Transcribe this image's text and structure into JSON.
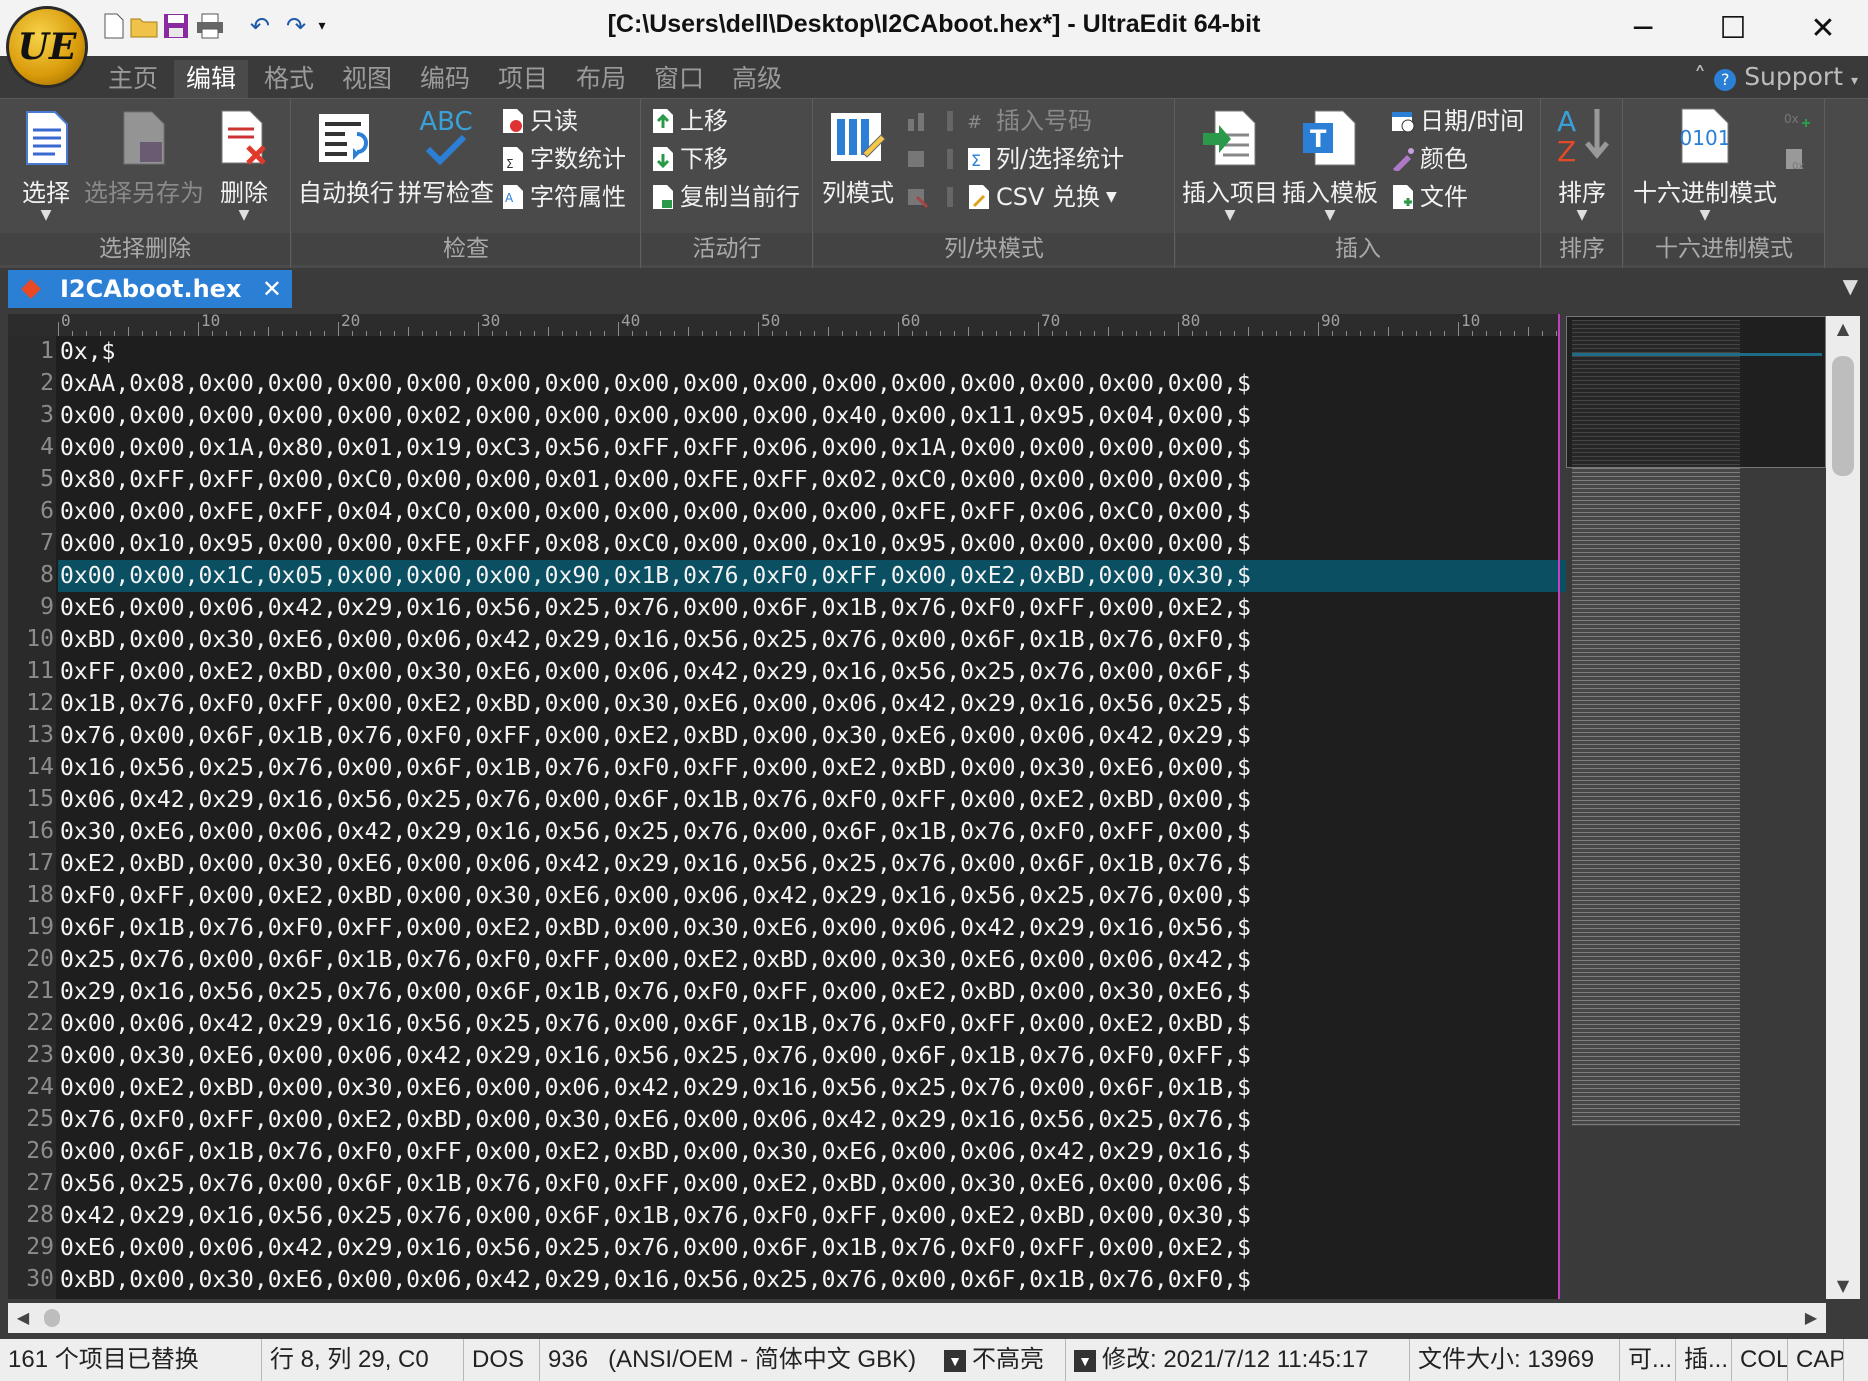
{
  "window": {
    "title": "[C:\\Users\\dell\\Desktop\\I2CAboot.hex*] - UltraEdit 64-bit",
    "logo_text": "UE",
    "controls": [
      "─",
      "☐",
      "✕"
    ]
  },
  "quick_access": [
    "new-file-icon",
    "open-folder-icon",
    "save-icon",
    "print-icon",
    "undo-icon",
    "redo-icon",
    "customize-dropdown-icon"
  ],
  "menu": {
    "tabs": [
      "主页",
      "编辑",
      "格式",
      "视图",
      "编码",
      "项目",
      "布局",
      "窗口",
      "高级"
    ],
    "active": "编辑",
    "support": "Support"
  },
  "ribbon": {
    "groups": {
      "select_delete": "选择删除",
      "check": "检查",
      "active_line": "活动行",
      "column_block": "列/块模式",
      "insert": "插入",
      "sort": "排序",
      "hex": "十六进制模式"
    },
    "buttons": {
      "select": "选择",
      "select_save_as": "选择另存为",
      "delete": "删除",
      "word_wrap": "自动换行",
      "spell_check": "拼写检查",
      "spell_icon_text": "ABC",
      "read_only": "只读",
      "word_count": "字数统计",
      "char_props": "字符属性",
      "move_up": "上移",
      "move_down": "下移",
      "copy_line": "复制当前行",
      "column_mode": "列模式",
      "insert_number": "插入号码",
      "column_stats": "列/选择统计",
      "csv_convert": "CSV 兑换",
      "insert_item": "插入项目",
      "insert_template": "插入模板",
      "datetime": "日期/时间",
      "color": "颜色",
      "file": "文件",
      "sort": "排序",
      "sort_icon_a": "A",
      "sort_icon_z": "Z",
      "hex_mode": "十六进制模式",
      "hex_icon_text": "0101"
    }
  },
  "tab": {
    "filename": "I2CAboot.hex",
    "close": "✕",
    "dropdown": "▼"
  },
  "ruler": {
    "labels": [
      "0",
      "10",
      "20",
      "30",
      "40",
      "50",
      "60",
      "70",
      "80",
      "90",
      "10"
    ]
  },
  "editor": {
    "current_line": 8,
    "lines": [
      "0x\u0019,$",
      "0xAA,0x08,0x00,0x00,0x00,0x00,0x00,0x00,0x00,0x00,0x00,0x00,0x00,0x00,0x00,0x00,0x00,$",
      "0x00,0x00,0x00,0x00,0x00,0x02,0x00,0x00,0x00,0x00,0x00,0x40,0x00,0x11,0x95,0x04,0x00,$",
      "0x00,0x00,0x1A,0x80,0x01,0x19,0xC3,0x56,0xFF,0xFF,0x06,0x00,0x1A,0x00,0x00,0x00,0x00,$",
      "0x80,0xFF,0xFF,0x00,0xC0,0x00,0x00,0x01,0x00,0xFE,0xFF,0x02,0xC0,0x00,0x00,0x00,0x00,$",
      "0x00,0x00,0xFE,0xFF,0x04,0xC0,0x00,0x00,0x00,0x00,0x00,0x00,0xFE,0xFF,0x06,0xC0,0x00,$",
      "0x00,0x10,0x95,0x00,0x00,0xFE,0xFF,0x08,0xC0,0x00,0x00,0x10,0x95,0x00,0x00,0x00,0x00,$",
      "0x00,0x00,0x1C,0x05,0x00,0x00,0x00,0x90,0x1B,0x76,0xF0,0xFF,0x00,0xE2,0xBD,0x00,0x30,$",
      "0xE6,0x00,0x06,0x42,0x29,0x16,0x56,0x25,0x76,0x00,0x6F,0x1B,0x76,0xF0,0xFF,0x00,0xE2,$",
      "0xBD,0x00,0x30,0xE6,0x00,0x06,0x42,0x29,0x16,0x56,0x25,0x76,0x00,0x6F,0x1B,0x76,0xF0,$",
      "0xFF,0x00,0xE2,0xBD,0x00,0x30,0xE6,0x00,0x06,0x42,0x29,0x16,0x56,0x25,0x76,0x00,0x6F,$",
      "0x1B,0x76,0xF0,0xFF,0x00,0xE2,0xBD,0x00,0x30,0xE6,0x00,0x06,0x42,0x29,0x16,0x56,0x25,$",
      "0x76,0x00,0x6F,0x1B,0x76,0xF0,0xFF,0x00,0xE2,0xBD,0x00,0x30,0xE6,0x00,0x06,0x42,0x29,$",
      "0x16,0x56,0x25,0x76,0x00,0x6F,0x1B,0x76,0xF0,0xFF,0x00,0xE2,0xBD,0x00,0x30,0xE6,0x00,$",
      "0x06,0x42,0x29,0x16,0x56,0x25,0x76,0x00,0x6F,0x1B,0x76,0xF0,0xFF,0x00,0xE2,0xBD,0x00,$",
      "0x30,0xE6,0x00,0x06,0x42,0x29,0x16,0x56,0x25,0x76,0x00,0x6F,0x1B,0x76,0xF0,0xFF,0x00,$",
      "0xE2,0xBD,0x00,0x30,0xE6,0x00,0x06,0x42,0x29,0x16,0x56,0x25,0x76,0x00,0x6F,0x1B,0x76,$",
      "0xF0,0xFF,0x00,0xE2,0xBD,0x00,0x30,0xE6,0x00,0x06,0x42,0x29,0x16,0x56,0x25,0x76,0x00,$",
      "0x6F,0x1B,0x76,0xF0,0xFF,0x00,0xE2,0xBD,0x00,0x30,0xE6,0x00,0x06,0x42,0x29,0x16,0x56,$",
      "0x25,0x76,0x00,0x6F,0x1B,0x76,0xF0,0xFF,0x00,0xE2,0xBD,0x00,0x30,0xE6,0x00,0x06,0x42,$",
      "0x29,0x16,0x56,0x25,0x76,0x00,0x6F,0x1B,0x76,0xF0,0xFF,0x00,0xE2,0xBD,0x00,0x30,0xE6,$",
      "0x00,0x06,0x42,0x29,0x16,0x56,0x25,0x76,0x00,0x6F,0x1B,0x76,0xF0,0xFF,0x00,0xE2,0xBD,$",
      "0x00,0x30,0xE6,0x00,0x06,0x42,0x29,0x16,0x56,0x25,0x76,0x00,0x6F,0x1B,0x76,0xF0,0xFF,$",
      "0x00,0xE2,0xBD,0x00,0x30,0xE6,0x00,0x06,0x42,0x29,0x16,0x56,0x25,0x76,0x00,0x6F,0x1B,$",
      "0x76,0xF0,0xFF,0x00,0xE2,0xBD,0x00,0x30,0xE6,0x00,0x06,0x42,0x29,0x16,0x56,0x25,0x76,$",
      "0x00,0x6F,0x1B,0x76,0xF0,0xFF,0x00,0xE2,0xBD,0x00,0x30,0xE6,0x00,0x06,0x42,0x29,0x16,$",
      "0x56,0x25,0x76,0x00,0x6F,0x1B,0x76,0xF0,0xFF,0x00,0xE2,0xBD,0x00,0x30,0xE6,0x00,0x06,$",
      "0x42,0x29,0x16,0x56,0x25,0x76,0x00,0x6F,0x1B,0x76,0xF0,0xFF,0x00,0xE2,0xBD,0x00,0x30,$",
      "0xE6,0x00,0x06,0x42,0x29,0x16,0x56,0x25,0x76,0x00,0x6F,0x1B,0x76,0xF0,0xFF,0x00,0xE2,$",
      "0xBD,0x00,0x30,0xE6,0x00,0x06,0x42,0x29,0x16,0x56,0x25,0x76,0x00,0x6F,0x1B,0x76,0xF0,$"
    ]
  },
  "status": {
    "replaced": "161 个项目已替换",
    "position": "行 8, 列 29, C0",
    "line_ending": "DOS",
    "codepage": "936",
    "encoding": "(ANSI/OEM - 简体中文 GBK)",
    "highlight": "不高亮",
    "modified": "修改:   2021/7/12 11:45:17",
    "filesize": "文件大小:   13969",
    "writable": "可...",
    "insert_mode": "插...",
    "col": "COL",
    "caps": "CAP"
  },
  "colors": {
    "accent": "#2b7fd4",
    "current_line": "#0b4f63",
    "editor_bg": "#1e1e1e",
    "margin_line": "#c040c0"
  }
}
